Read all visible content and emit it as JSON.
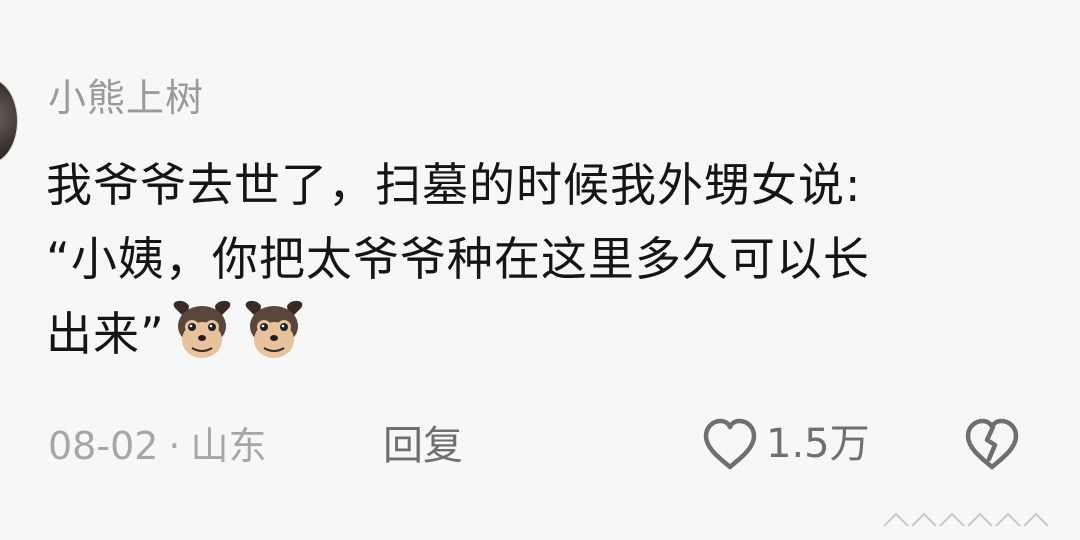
{
  "comment": {
    "username": "小熊上树",
    "text_lines": [
      "我爷爷去世了，扫墓的时候我外甥女说:",
      "“小姨，你把太爷爷种在这里多久可以长",
      "出来”"
    ],
    "emojis": [
      "dog-face-emoji",
      "dog-face-emoji"
    ],
    "date": "08-02",
    "separator": "·",
    "location": "山东",
    "reply_label": "回复",
    "like_count": "1.5万"
  },
  "icons": {
    "like": "heart-outline-icon",
    "dislike": "broken-heart-icon"
  },
  "colors": {
    "background": "#f7f7f7",
    "text_primary": "#151515",
    "text_secondary": "#9a9a9a",
    "action_text": "#6f6f6f"
  }
}
